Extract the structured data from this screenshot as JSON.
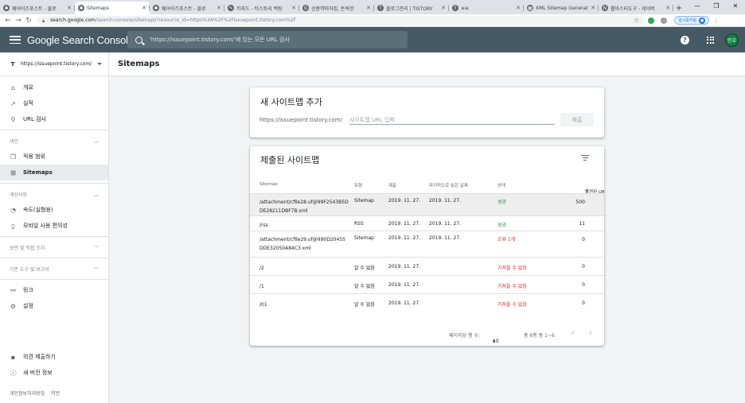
{
  "browser": {
    "tabs": [
      {
        "title": "웨어이즈포스트 - 블로",
        "fav": "✱"
      },
      {
        "title": "Sitemaps",
        "fav": "✱"
      },
      {
        "title": "웨어이즈포스트 - 블로",
        "fav": "✱"
      },
      {
        "title": "키자드 - 티스토리 백링",
        "fav": "✎"
      },
      {
        "title": "선종역피자집, 돈독한 ",
        "fav": "G"
      },
      {
        "title": "블로그관리 | TISTORY",
        "fav": "T"
      },
      {
        "title": "≡≡",
        "fav": "T"
      },
      {
        "title": "XML Sitemap Generat",
        "fav": "▦"
      },
      {
        "title": "웹마스터도구 - 네이버",
        "fav": "N"
      }
    ],
    "url_domain": "search.google.com",
    "url_rest": "/search-console/sitemaps?resource_id=https%3A%2F%2Fissuepoint.tistory.com%2F",
    "pause_label": "일시중지됨"
  },
  "header": {
    "product": "Google Search Console",
    "search_placeholder": "'https://issuepoint.tistory.com/'에 있는 모든 URL 검사",
    "avatar_initials": "민호"
  },
  "sidebar": {
    "property": "https://issuepoint.tistory.com/",
    "top_items": [
      {
        "label": "개요"
      },
      {
        "label": "실적"
      },
      {
        "label": "URL 검사"
      }
    ],
    "sections": {
      "index": "색인",
      "enhancements": "개선사항",
      "security": "보안 및 직접 조치",
      "legacy": "기존 도구 및 보고서"
    },
    "index_items": [
      {
        "label": "적용 범위"
      },
      {
        "label": "Sitemaps"
      }
    ],
    "enhancement_items": [
      {
        "label": "속도(실험용)"
      },
      {
        "label": "모바일 사용 편의성"
      }
    ],
    "bottom_items": [
      {
        "label": "링크"
      },
      {
        "label": "설정"
      }
    ],
    "footer_items": [
      {
        "label": "의견 제출하기"
      },
      {
        "label": "새 버전 정보"
      }
    ],
    "footer_links": {
      "privacy": "개인정보처리방침",
      "terms": "약관"
    }
  },
  "page": {
    "title": "Sitemaps"
  },
  "add_sitemap": {
    "title": "새 사이트맵 추가",
    "prefix": "https://issuepoint.tistory.com/",
    "placeholder": "사이트맵 URL 입력",
    "submit": "제출"
  },
  "submitted": {
    "title": "제출된 사이트맵",
    "columns": {
      "sitemap": "Sitemap",
      "type": "유형",
      "submitted": "제출",
      "last_read": "마지막으로 읽은 날짜",
      "status": "상태",
      "discovered": "발견된 URL 수"
    },
    "rows": [
      {
        "sitemap": "/attachment/cfile28.uf@99F2543B5DDE28211DBF7B.xml",
        "type": "Sitemap",
        "submitted": "2019. 11. 27.",
        "last_read": "2019. 11. 27.",
        "status": "성공",
        "status_kind": "ok",
        "urls": "500"
      },
      {
        "sitemap": "/rss",
        "type": "RSS",
        "submitted": "2019. 11. 27.",
        "last_read": "2019. 11. 27.",
        "status": "성공",
        "status_kind": "ok",
        "urls": "11"
      },
      {
        "sitemap": "/attachment/cfile29.uf@990D20455DDE32050A84C3.xml",
        "type": "Sitemap",
        "submitted": "2019. 11. 27.",
        "last_read": "2019. 11. 27.",
        "status": "오류 1개",
        "status_kind": "err",
        "urls": "0"
      },
      {
        "sitemap": "/2",
        "type": "알 수 없음",
        "submitted": "2019. 11. 27.",
        "last_read": "",
        "status": "가져올 수 없음",
        "status_kind": "err",
        "urls": "0"
      },
      {
        "sitemap": "/1",
        "type": "알 수 없음",
        "submitted": "2019. 11. 27.",
        "last_read": "",
        "status": "가져올 수 없음",
        "status_kind": "err",
        "urls": "0"
      },
      {
        "sitemap": "/01",
        "type": "알 수 없음",
        "submitted": "2019. 11. 27.",
        "last_read": "",
        "status": "가져올 수 없음",
        "status_kind": "err",
        "urls": "0"
      }
    ],
    "pagination": {
      "rows_label": "페이지당 행 수:",
      "rows_value": "10",
      "range": "총 6행 중 1~6"
    }
  },
  "colors": {
    "header_bg": "#455a64",
    "success": "#188038",
    "error": "#d93025"
  }
}
